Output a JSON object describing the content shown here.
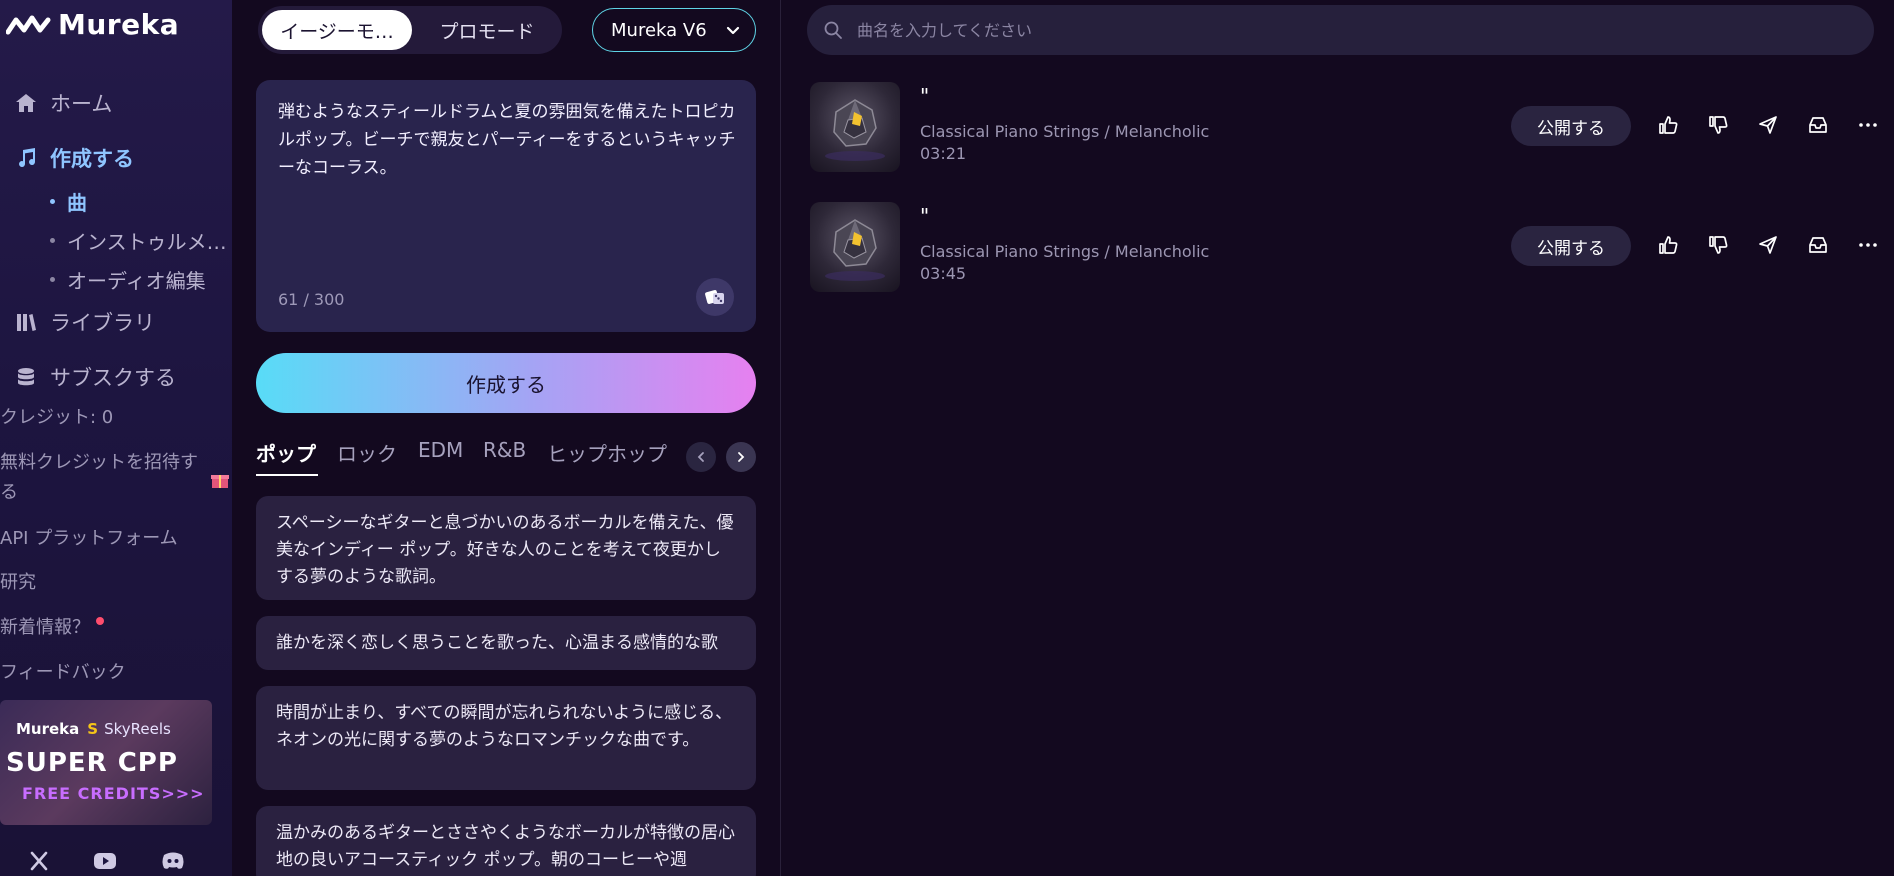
{
  "brand": {
    "name": "Mureka"
  },
  "sidebar": {
    "nav": [
      {
        "label": "ホーム",
        "icon": "home-icon"
      },
      {
        "label": "作成する",
        "icon": "music-note-icon",
        "active": true
      },
      {
        "label": "ライブラリ",
        "icon": "library-icon"
      },
      {
        "label": "サブスクする",
        "icon": "database-icon"
      }
    ],
    "create_sub": [
      {
        "label": "曲",
        "active": true
      },
      {
        "label": "インストゥルメ…"
      },
      {
        "label": "オーディオ編集"
      }
    ],
    "credits": "クレジット: 0",
    "invite": "無料クレジットを招待する",
    "api": "API プラットフォーム",
    "research": "研究",
    "news": "新着情報？",
    "feedback": "フィードバック",
    "banner": {
      "brand1": "Mureka",
      "brand2": "SkyReels",
      "title": "SUPER CPP",
      "subtitle": "FREE CREDITS>>>"
    },
    "social": [
      "x-icon",
      "youtube-icon",
      "discord-icon"
    ]
  },
  "mode": {
    "easy": "イージーモ…",
    "pro": "プロモード"
  },
  "version": {
    "label": "Mureka V6"
  },
  "prompt": {
    "text": "弾むようなスティールドラムと夏の雰囲気を備えたトロピカルポップ。ビーチで親友とパーティーをするというキャッチーなコーラス。",
    "counter": "61 / 300"
  },
  "create_button": "作成する",
  "genres": [
    "ポップ",
    "ロック",
    "EDM",
    "R&B",
    "ヒップホップ"
  ],
  "suggestions": [
    "スペーシーなギターと息づかいのあるボーカルを備えた、優美なインディー ポップ。好きな人のことを考えて夜更かしする夢のような歌詞。",
    "誰かを深く恋しく思うことを歌った、心温まる感情的な歌",
    "時間が止まり、すべての瞬間が忘れられないように感じる、ネオンの光に関する夢のようなロマンチックな曲です。",
    "温かみのあるギターとささやくようなボーカルが特徴の居心地の良いアコースティック ポップ。朝のコーヒーや週"
  ],
  "search": {
    "placeholder": "曲名を入力してください"
  },
  "songs": [
    {
      "title": "\"",
      "style": "Classical Piano Strings / Melancholic",
      "duration": "03:21",
      "publish": "公開する"
    },
    {
      "title": "\"",
      "style": "Classical Piano Strings / Melancholic",
      "duration": "03:45",
      "publish": "公開する"
    }
  ],
  "colors": {
    "accent_blue": "#8fc5ff",
    "version_border": "#5fd4e6",
    "create_gradient_start": "#58dcf7",
    "create_gradient_end": "#e680f0"
  }
}
